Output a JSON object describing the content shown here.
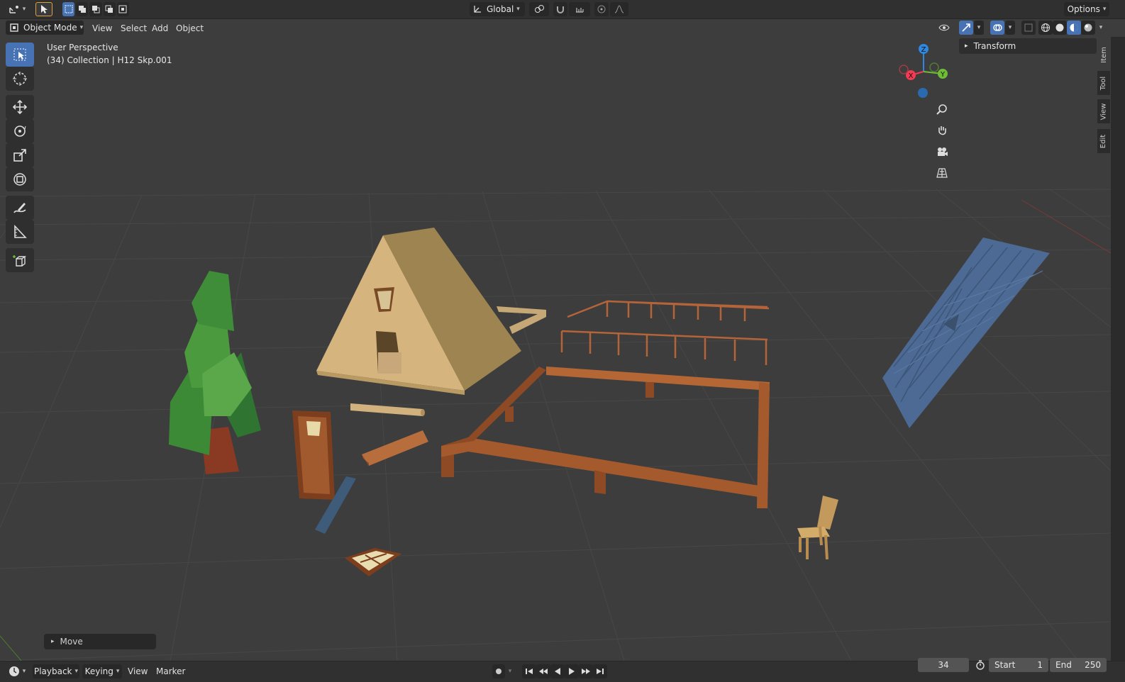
{
  "top_header": {
    "editor_type_icon": "editor-type-icon",
    "select_tool_icon": "cursor-select-icon",
    "transform_orientation": "Global",
    "options_label": "Options"
  },
  "view_header": {
    "mode": "Object Mode",
    "menus": [
      "View",
      "Select",
      "Add",
      "Object"
    ]
  },
  "viewport": {
    "perspective": "User Perspective",
    "collection": "(34) Collection | H12 Skp.001",
    "grid_color": "#4a4a4a",
    "background": "#3d3d3d"
  },
  "toolbar": {
    "tools": [
      "select-box-icon",
      "cursor-icon",
      "move-icon",
      "rotate-icon",
      "scale-icon",
      "transform-icon",
      "annotate-icon",
      "measure-icon",
      "add-cube-icon"
    ]
  },
  "gizmo": {
    "axes": [
      "X",
      "Y",
      "Z"
    ],
    "colors": {
      "x": "#f53a54",
      "y": "#6fbd37",
      "z": "#2e88df"
    }
  },
  "sidebar": {
    "panel_title": "Transform",
    "tabs": [
      "Item",
      "Tool",
      "View",
      "Edit"
    ]
  },
  "last_operator": "Move",
  "timeline": {
    "menus": [
      "Playback",
      "Keying",
      "View",
      "Marker"
    ],
    "current_frame": "34",
    "start_label": "Start",
    "start_value": "1",
    "end_label": "End",
    "end_value": "250"
  }
}
